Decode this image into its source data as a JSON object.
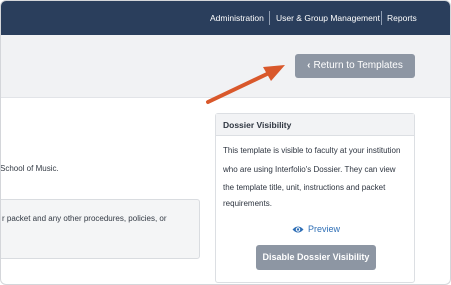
{
  "topnav": {
    "items": [
      {
        "label": "Administration"
      },
      {
        "label": "User & Group Management"
      },
      {
        "label": "Reports"
      }
    ]
  },
  "header": {
    "return_button_label": "Return to Templates",
    "return_icon": "chevron-left-icon"
  },
  "main": {
    "partial_line_1": "School of Music.",
    "info_box_partial_line": "r packet and any other procedures, policies, or"
  },
  "dossier_panel": {
    "title": "Dossier Visibility",
    "description_lines": [
      "This template is visible to faculty at your institution",
      "who are using Interfolio's Dossier. They can view",
      "the template title, unit, instructions and packet",
      "requirements."
    ],
    "preview_label": "Preview",
    "preview_icon": "eye-icon",
    "disable_button_label": "Disable Dossier Visibility"
  },
  "colors": {
    "nav_bg": "#2a3e5c",
    "button_gray": "#8d96a3",
    "link_blue": "#2f6fb6",
    "annotation_arrow": "#d9582b"
  }
}
